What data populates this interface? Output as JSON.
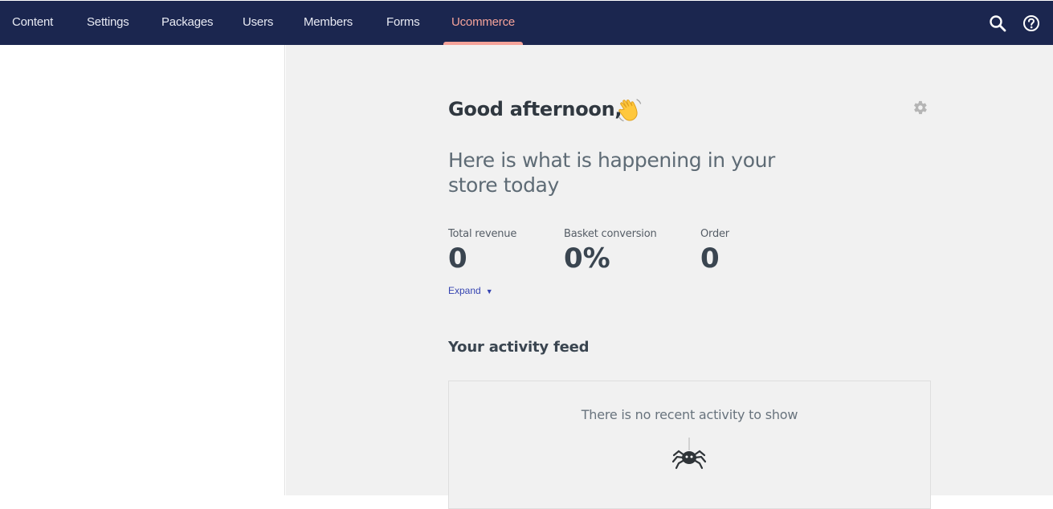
{
  "nav": {
    "items": [
      {
        "label": "Content"
      },
      {
        "label": "Settings"
      },
      {
        "label": "Packages"
      },
      {
        "label": "Users"
      },
      {
        "label": "Members"
      },
      {
        "label": "Forms"
      },
      {
        "label": "Ucommerce",
        "active": true
      }
    ],
    "icons": [
      "search-icon",
      "help-icon"
    ]
  },
  "dashboard": {
    "greeting": "Good afternoon,",
    "greeting_icon": "waving-hand-icon",
    "settings_icon": "gear-icon",
    "subtitle": "Here is what is happening in your store today",
    "kpis": [
      {
        "label": "Total revenue",
        "value": "0"
      },
      {
        "label": "Basket conversion",
        "value": "0%"
      },
      {
        "label": "Order",
        "value": "0"
      }
    ],
    "expand_label": "Expand",
    "expand_icon": "caret-down-icon",
    "feed": {
      "title": "Your activity feed",
      "empty_message": "There is no recent activity to show",
      "empty_icon": "spider-icon"
    }
  },
  "colors": {
    "topbar": "#1b264f",
    "active_nav": "#f5a39a",
    "link": "#3544b1",
    "main_bg": "#f1f1f1"
  }
}
